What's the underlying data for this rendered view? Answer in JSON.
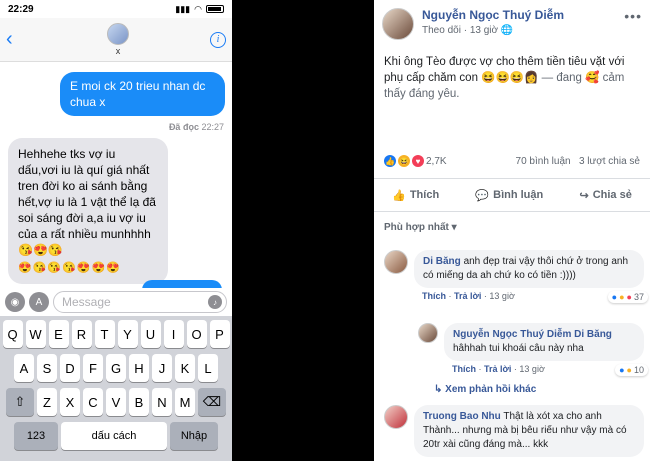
{
  "imessage": {
    "status": {
      "time": "22:29",
      "carrier": "⇗"
    },
    "nav": {
      "back": "‹",
      "contact_name": "x",
      "info": "i"
    },
    "outgoing": {
      "text": "E moi ck 20 trieu nhan dc chua x"
    },
    "read_receipt": {
      "label": "Đã đọc",
      "time": "22:27"
    },
    "incoming": {
      "text": "Hehhehe tks vợ iu dấu,vơi iu là quí giá nhất tren đời ko ai sánh bằng hết,vợ iu là 1 vật thể lạ đã soi sáng đời a,a iu vợ iu của a rất nhiều munhhhh",
      "emoji_line1": "😘😍😘",
      "emoji_line2": "😍😘😘😘😍😍😍"
    },
    "input": {
      "placeholder": "Message"
    },
    "keyboard": {
      "row1": [
        "Q",
        "W",
        "E",
        "R",
        "T",
        "Y",
        "U",
        "I",
        "O",
        "P"
      ],
      "row2": [
        "A",
        "S",
        "D",
        "F",
        "G",
        "H",
        "J",
        "K",
        "L"
      ],
      "row3": [
        "Z",
        "X",
        "C",
        "V",
        "B",
        "N",
        "M"
      ],
      "shift": "⇧",
      "delete": "⌫",
      "mode": "123",
      "space": "dấu cách",
      "go": "Nhập"
    }
  },
  "facebook": {
    "author": "Nguyễn Ngọc Thuý Diễm",
    "follow": "Theo dõi",
    "time": "13 giờ",
    "post_text": "Khi ông Tèo được vợ cho thêm tiền tiêu vặt với phụ cấp chăm con",
    "post_emojis": "😆😆😆👩",
    "post_feeling": "— đang 🥰 cảm thấy đáng yêu.",
    "reaction_count": "2,7K",
    "comments_count": "70 bình luận",
    "shares_count": "3 lượt chia sẻ",
    "actions": {
      "like": "Thích",
      "comment": "Bình luận",
      "share": "Chia sẻ"
    },
    "sort": "Phù hợp nhất ▾",
    "comments": [
      {
        "user": "Di Băng",
        "text": "anh đẹp trai vậy thôi chứ ở trong anh có miếng da ah chứ ko có tiền :))))",
        "like": "Thích",
        "reply": "Trả lời",
        "time": "13 giờ",
        "reactions": "37"
      },
      {
        "user": "Nguyễn Ngọc Thuý Diễm",
        "mention": "Di Băng",
        "text": "hâhhah tui khoái câu này nha",
        "like": "Thích",
        "reply": "Trả lời",
        "time": "13 giờ",
        "reactions": "10"
      },
      {
        "user": "Truong Bao Nhu",
        "text": "Thật là xót xa cho anh Thành... nhưng mà bị bêu riếu như vậy mà có 20tr xài cũng đáng mà... kkk"
      }
    ],
    "more_replies": "↳ Xem phản hồi khác",
    "colors": {
      "link": "#385898",
      "like_blue": "#1877f2",
      "love_red": "#f33e58",
      "haha_yellow": "#f7b125"
    }
  }
}
